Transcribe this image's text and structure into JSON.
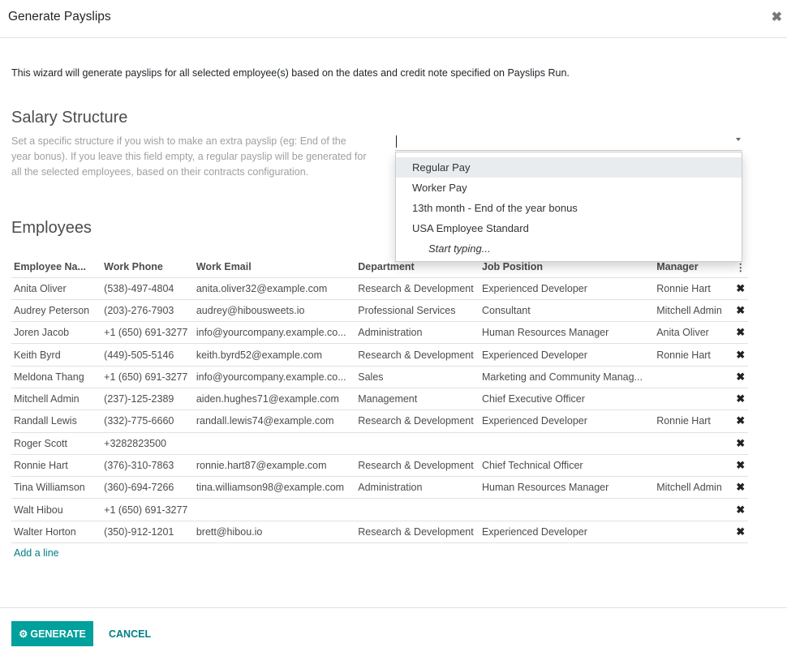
{
  "dialog": {
    "title": "Generate Payslips",
    "close_icon": "close-icon"
  },
  "intro_text": "This wizard will generate payslips for all selected employee(s) based on the dates and credit note specified on Payslips Run.",
  "salary_structure": {
    "heading": "Salary Structure",
    "help": "Set a specific structure if you wish to make an extra payslip (eg: End of the year bonus). If you leave this field empty, a regular payslip will be generated for all the selected employees, based on their contracts configuration.",
    "value": "",
    "options": [
      "Regular Pay",
      "Worker Pay",
      "13th month - End of the year bonus",
      "USA Employee Standard"
    ],
    "highlighted_option": "Regular Pay",
    "hint": "Start typing..."
  },
  "employees": {
    "heading": "Employees",
    "columns": [
      "Employee Na...",
      "Work Phone",
      "Work Email",
      "Department",
      "Job Position",
      "Manager"
    ],
    "rows": [
      [
        "Anita Oliver",
        "(538)-497-4804",
        "anita.oliver32@example.com",
        "Research & Development",
        "Experienced Developer",
        "Ronnie Hart"
      ],
      [
        "Audrey Peterson",
        "(203)-276-7903",
        "audrey@hibousweets.io",
        "Professional Services",
        "Consultant",
        "Mitchell Admin"
      ],
      [
        "Joren Jacob",
        "+1 (650) 691-3277",
        "info@yourcompany.example.co...",
        "Administration",
        "Human Resources Manager",
        "Anita Oliver"
      ],
      [
        "Keith Byrd",
        "(449)-505-5146",
        "keith.byrd52@example.com",
        "Research & Development",
        "Experienced Developer",
        "Ronnie Hart"
      ],
      [
        "Meldona Thang",
        "+1 (650) 691-3277",
        "info@yourcompany.example.co...",
        "Sales",
        "Marketing and Community Manag...",
        ""
      ],
      [
        "Mitchell Admin",
        "(237)-125-2389",
        "aiden.hughes71@example.com",
        "Management",
        "Chief Executive Officer",
        ""
      ],
      [
        "Randall Lewis",
        "(332)-775-6660",
        "randall.lewis74@example.com",
        "Research & Development",
        "Experienced Developer",
        "Ronnie Hart"
      ],
      [
        "Roger Scott",
        "+3282823500",
        "",
        "",
        "",
        ""
      ],
      [
        "Ronnie Hart",
        "(376)-310-7863",
        "ronnie.hart87@example.com",
        "Research & Development",
        "Chief Technical Officer",
        ""
      ],
      [
        "Tina Williamson",
        "(360)-694-7266",
        "tina.williamson98@example.com",
        "Administration",
        "Human Resources Manager",
        "Mitchell Admin"
      ],
      [
        "Walt Hibou",
        "+1 (650) 691-3277",
        "",
        "",
        "",
        ""
      ],
      [
        "Walter Horton",
        "(350)-912-1201",
        "brett@hibou.io",
        "Research & Development",
        "Experienced Developer",
        ""
      ]
    ],
    "add_line": "Add a line"
  },
  "footer": {
    "generate_label": "GENERATE",
    "cancel_label": "CANCEL"
  },
  "colors": {
    "primary": "#00a09d",
    "link": "#017e84"
  }
}
